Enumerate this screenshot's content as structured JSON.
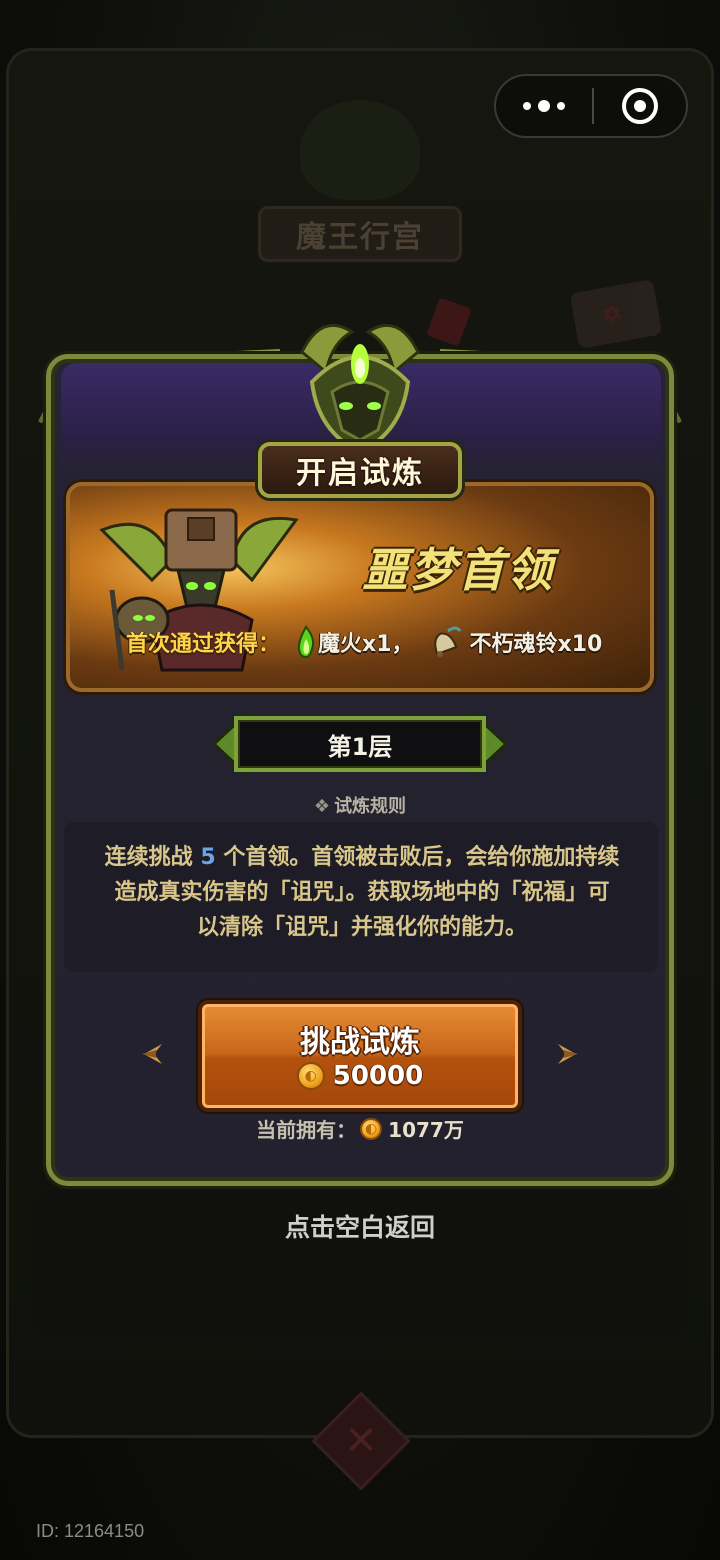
{
  "background": {
    "title": "魔王行宫"
  },
  "dialog": {
    "title": "开启试炼",
    "banner": {
      "boss_name": "噩梦首领",
      "reward_label": "首次通过获得：",
      "rewards": [
        {
          "icon": "green-flame-icon",
          "text": "魔火x1，"
        },
        {
          "icon": "bell-icon",
          "text": "不朽魂铃x10"
        }
      ]
    },
    "floor": "第1层",
    "rules_title": "试炼规则",
    "rules": {
      "line1_pre": "连续挑战 ",
      "boss_count": "5",
      "line1_post": " 个首领。首领被击败后，会给你施加持续",
      "line2": "造成真实伤害的「诅咒」。获取场地中的「祝福」可",
      "line3": "以清除「诅咒」并强化你的能力。"
    },
    "challenge_button": {
      "label": "挑战试炼",
      "cost": "50000"
    },
    "owned": {
      "label": "当前拥有：",
      "value": "1077万"
    }
  },
  "tap_hint": "点击空白返回",
  "id_text": "ID: 12164150",
  "colors": {
    "accent_green": "#7fa238",
    "button_orange": "#c8651a",
    "highlight_blue": "#6aa3e6",
    "gold_text": "#ffd54a"
  }
}
